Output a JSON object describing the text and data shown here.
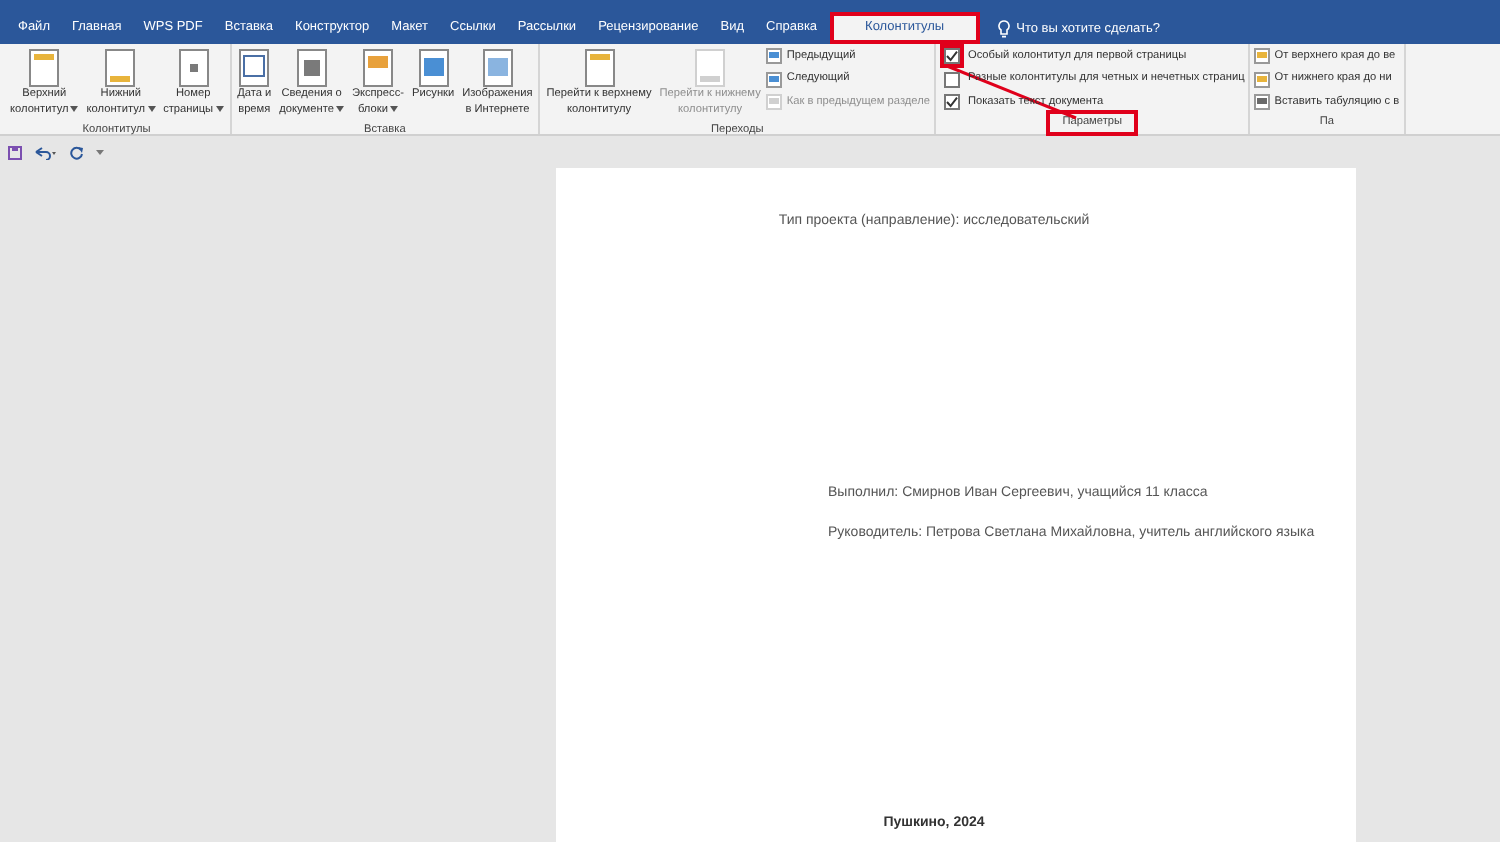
{
  "tabs": [
    {
      "label": "Файл",
      "selected": false,
      "highlighted": false
    },
    {
      "label": "Главная",
      "selected": false,
      "highlighted": false
    },
    {
      "label": "WPS PDF",
      "selected": false,
      "highlighted": false
    },
    {
      "label": "Вставка",
      "selected": false,
      "highlighted": false
    },
    {
      "label": "Конструктор",
      "selected": false,
      "highlighted": false
    },
    {
      "label": "Макет",
      "selected": false,
      "highlighted": false
    },
    {
      "label": "Ссылки",
      "selected": false,
      "highlighted": false
    },
    {
      "label": "Рассылки",
      "selected": false,
      "highlighted": false
    },
    {
      "label": "Рецензирование",
      "selected": false,
      "highlighted": false
    },
    {
      "label": "Вид",
      "selected": false,
      "highlighted": false
    },
    {
      "label": "Справка",
      "selected": false,
      "highlighted": false
    },
    {
      "label": "Колонтитулы",
      "selected": true,
      "highlighted": true
    }
  ],
  "tell_me": {
    "label": "Что вы хотите сделать?"
  },
  "ribbon": {
    "groups": [
      {
        "label": "Колонтитулы",
        "highlighted": false,
        "items": [
          {
            "kind": "large",
            "lines": [
              "Верхний",
              "колонтитул"
            ],
            "dropdown": true,
            "disabled": false
          },
          {
            "kind": "large",
            "lines": [
              "Нижний",
              "колонтитул"
            ],
            "dropdown": true,
            "disabled": false
          },
          {
            "kind": "large",
            "lines": [
              "Номер",
              "страницы"
            ],
            "dropdown": true,
            "disabled": false
          }
        ]
      },
      {
        "label": "Вставка",
        "highlighted": false,
        "items": [
          {
            "kind": "large",
            "lines": [
              "Дата и",
              "время"
            ],
            "dropdown": false,
            "disabled": false
          },
          {
            "kind": "large",
            "lines": [
              "Сведения о",
              "документе"
            ],
            "dropdown": true,
            "disabled": false
          },
          {
            "kind": "large",
            "lines": [
              "Экспресс-",
              "блоки"
            ],
            "dropdown": true,
            "disabled": false
          },
          {
            "kind": "large",
            "lines": [
              "Рисунки"
            ],
            "dropdown": false,
            "disabled": false
          },
          {
            "kind": "large",
            "lines": [
              "Изображения",
              "в Интернете"
            ],
            "dropdown": false,
            "disabled": false
          }
        ]
      },
      {
        "label": "Переходы",
        "highlighted": false,
        "items": [
          {
            "kind": "large",
            "lines": [
              "Перейти к верхнему",
              "колонтитулу"
            ],
            "dropdown": false,
            "disabled": false
          },
          {
            "kind": "large",
            "lines": [
              "Перейти к нижнему",
              "колонтитулу"
            ],
            "dropdown": false,
            "disabled": true
          },
          {
            "kind": "small",
            "label": "Предыдущий",
            "disabled": false
          },
          {
            "kind": "small",
            "label": "Следующий",
            "disabled": false
          },
          {
            "kind": "small",
            "label": "Как в предыдущем разделе",
            "disabled": true
          }
        ]
      },
      {
        "label": "Параметры",
        "highlighted": true,
        "items": [
          {
            "kind": "checkbox",
            "label": "Особый колонтитул для первой страницы",
            "checked": true,
            "highlighted": true
          },
          {
            "kind": "checkbox",
            "label": "Разные колонтитулы для четных и нечетных страниц",
            "checked": false,
            "highlighted": false
          },
          {
            "kind": "checkbox",
            "label": "Показать текст документа",
            "checked": true,
            "highlighted": false
          }
        ]
      },
      {
        "label": "Па",
        "highlighted": false,
        "items": [
          {
            "kind": "small",
            "label": "От верхнего края до ве",
            "disabled": false
          },
          {
            "kind": "small",
            "label": "От нижнего края до ни",
            "disabled": false
          },
          {
            "kind": "small",
            "label": "Вставить табуляцию с в",
            "disabled": false
          }
        ]
      }
    ]
  },
  "document": {
    "lines": [
      {
        "kind": "center",
        "text": "Тип проекта (направление): исследовательский"
      },
      {
        "kind": "gap"
      },
      {
        "kind": "left",
        "text": "Выполнил: Смирнов Иван Сергеевич, учащийся 11 класса"
      },
      {
        "kind": "left",
        "text": "Руководитель: Петрова Светлана Михайловна, учитель английского языка"
      },
      {
        "kind": "gap"
      },
      {
        "kind": "bold-center",
        "text": "Пушкино, 2024"
      }
    ]
  }
}
